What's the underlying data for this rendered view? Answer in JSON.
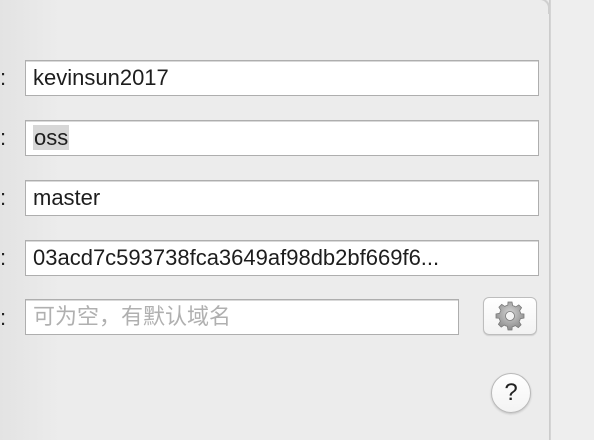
{
  "form": {
    "rows": [
      {
        "colon": ":",
        "value": "kevinsun2017"
      },
      {
        "colon": ":",
        "value": "oss"
      },
      {
        "colon": ":",
        "value": "master"
      },
      {
        "colon": ":",
        "value": "03acd7c593738fca3649af98db2bf669f6..."
      },
      {
        "colon": ":",
        "value": "",
        "placeholder": "可为空，有默认域名"
      }
    ]
  },
  "buttons": {
    "settings_icon": "gear-icon",
    "help_label": "?"
  }
}
